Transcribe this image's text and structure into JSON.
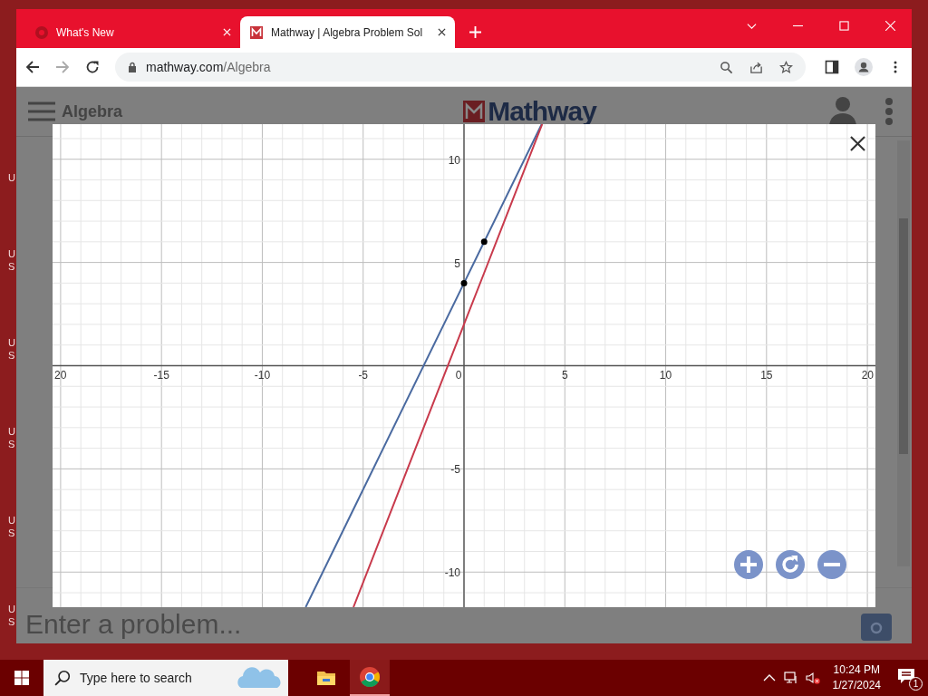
{
  "desktop_icons": [
    {
      "lines": [
        "U"
      ]
    },
    {
      "lines": [
        "U",
        "S"
      ]
    },
    {
      "lines": [
        "U",
        "S"
      ]
    },
    {
      "lines": [
        "U",
        "S"
      ]
    },
    {
      "lines": [
        "U",
        "S"
      ]
    },
    {
      "lines": [
        "U",
        "S"
      ]
    }
  ],
  "browser": {
    "tabs": [
      {
        "title": "What's New",
        "selected": false
      },
      {
        "title": "Mathway | Algebra Problem Sol",
        "selected": true
      }
    ],
    "url_host": "mathway.com",
    "url_path": "/Algebra"
  },
  "page": {
    "section": "Algebra",
    "logo": "Mathway",
    "input": {
      "placeholder": "Enter a problem..."
    }
  },
  "graph": {
    "chart_data": {
      "type": "line",
      "grid": true,
      "x": [
        -7.85,
        -5.48,
        0,
        1,
        3.85,
        3.88
      ],
      "xlim": [
        -20.4,
        20.4
      ],
      "ylim": [
        -11.7,
        11.7
      ],
      "series": [
        {
          "type": "line",
          "color": "#4a6aa0",
          "values": [
            -11.7,
            -6.96,
            4,
            6,
            11.7,
            null
          ]
        },
        {
          "type": "line",
          "color": "#c83a4c",
          "values": [
            null,
            -11.7,
            2,
            4.5,
            null,
            11.7
          ]
        },
        {
          "type": "scatter",
          "color": "#000000",
          "values": [
            null,
            null,
            4,
            6,
            null,
            null
          ]
        }
      ],
      "xticks": [
        {
          "value": -20,
          "label": "20"
        },
        -15,
        -10,
        -5,
        0,
        5,
        10,
        15,
        20
      ],
      "yticks": [
        -10,
        -5,
        5,
        10
      ]
    }
  },
  "taskbar": {
    "search_placeholder": "Type here to search",
    "time": "10:24 PM",
    "date": "1/27/2024",
    "notifications": "1"
  }
}
